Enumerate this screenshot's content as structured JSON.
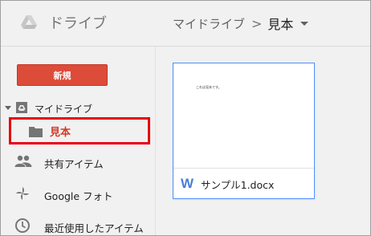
{
  "app": {
    "title": "ドライブ"
  },
  "breadcrumb": {
    "root": "マイドライブ",
    "separator": ">",
    "current": "見本"
  },
  "sidebar": {
    "new_button": "新規",
    "tree": {
      "label": "マイドライブ",
      "expanded": true
    },
    "folder": {
      "label": "見本",
      "selected": true
    },
    "items": [
      {
        "label": "共有アイテム",
        "icon": "people-icon"
      },
      {
        "label": "Google フォト",
        "icon": "pinwheel-icon"
      },
      {
        "label": "最近使用したアイテム",
        "icon": "clock-icon"
      }
    ]
  },
  "file": {
    "name": "サンプル1.docx",
    "preview_text": "これは見本です。",
    "type_letter": "W",
    "type_icon": "word-doc-icon"
  },
  "colors": {
    "new_button": "#dd4b39",
    "highlight_border": "#e8000f",
    "selected_folder_text": "#d03c2b",
    "card_border": "#4d90fe",
    "word_blue": "#4a7ed9"
  }
}
